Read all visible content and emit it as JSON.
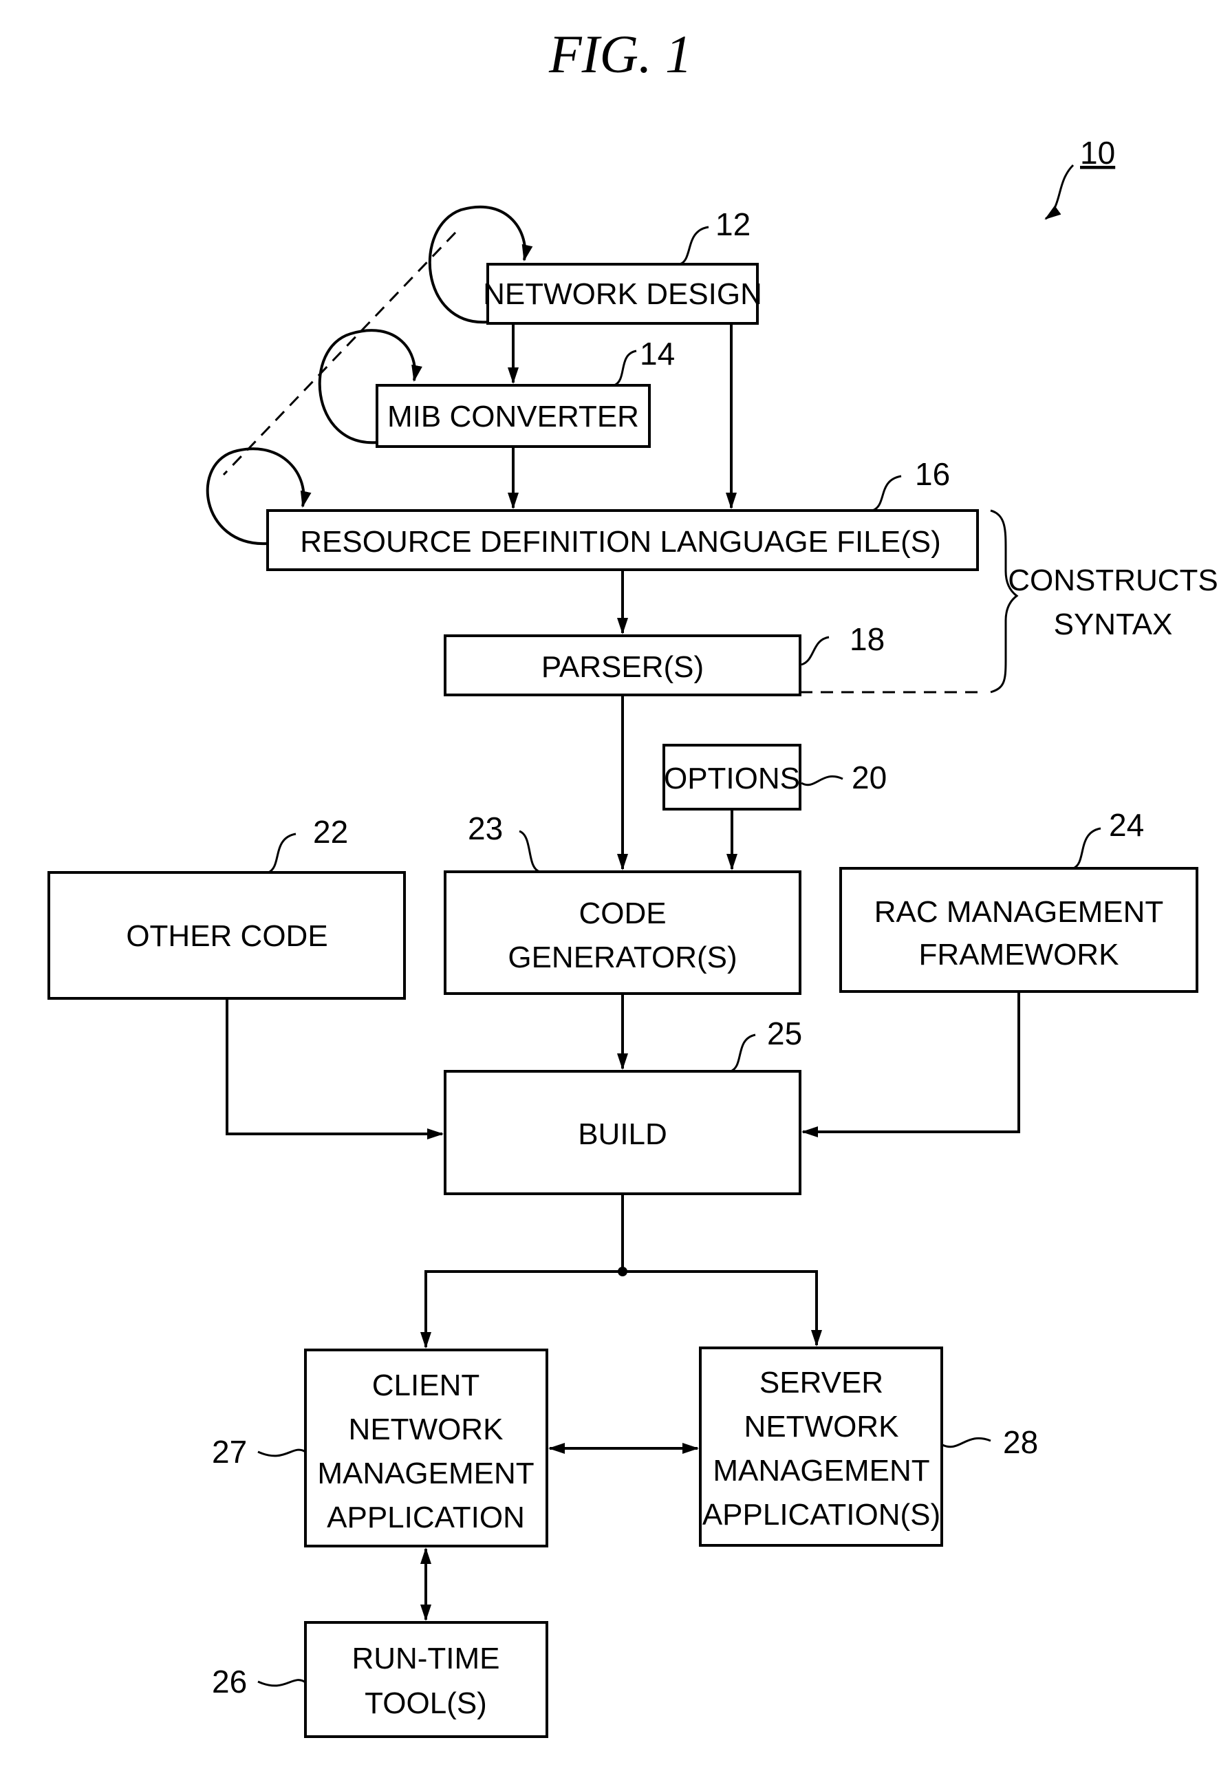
{
  "figure": {
    "title": "FIG. 1",
    "system_ref": "10"
  },
  "nodes": {
    "network_design": {
      "ref": "12",
      "lines": [
        "NETWORK DESIGN"
      ]
    },
    "mib_converter": {
      "ref": "14",
      "lines": [
        "MIB CONVERTER"
      ]
    },
    "rdl_files": {
      "ref": "16",
      "lines": [
        "RESOURCE DEFINITION LANGUAGE FILE(S)"
      ]
    },
    "parsers": {
      "ref": "18",
      "lines": [
        "PARSER(S)"
      ]
    },
    "options": {
      "ref": "20",
      "lines": [
        "OPTIONS"
      ]
    },
    "other_code": {
      "ref": "22",
      "lines": [
        "OTHER CODE"
      ]
    },
    "code_generators": {
      "ref": "23",
      "lines": [
        "CODE",
        "GENERATOR(S)"
      ]
    },
    "rac_framework": {
      "ref": "24",
      "lines": [
        "RAC MANAGEMENT",
        "FRAMEWORK"
      ]
    },
    "build": {
      "ref": "25",
      "lines": [
        "BUILD"
      ]
    },
    "runtime_tools": {
      "ref": "26",
      "lines": [
        "RUN-TIME",
        "TOOL(S)"
      ]
    },
    "client_app": {
      "ref": "27",
      "lines": [
        "CLIENT",
        "NETWORK",
        "MANAGEMENT",
        "APPLICATION"
      ]
    },
    "server_app": {
      "ref": "28",
      "lines": [
        "SERVER",
        "NETWORK",
        "MANAGEMENT",
        "APPLICATION(S)"
      ]
    }
  },
  "brace_label": [
    "CONSTRUCTS",
    "SYNTAX"
  ],
  "edges": [
    {
      "from": "network_design",
      "to": "mib_converter"
    },
    {
      "from": "network_design",
      "to": "rdl_files"
    },
    {
      "from": "mib_converter",
      "to": "rdl_files"
    },
    {
      "from": "rdl_files",
      "to": "parsers"
    },
    {
      "from": "parsers",
      "to": "code_generators"
    },
    {
      "from": "options",
      "to": "code_generators"
    },
    {
      "from": "code_generators",
      "to": "build"
    },
    {
      "from": "other_code",
      "to": "build"
    },
    {
      "from": "rac_framework",
      "to": "build"
    },
    {
      "from": "build",
      "to": "client_app"
    },
    {
      "from": "build",
      "to": "server_app"
    },
    {
      "from": "client_app",
      "to": "server_app",
      "bidirectional": true
    },
    {
      "from": "client_app",
      "to": "runtime_tools",
      "bidirectional": true
    },
    {
      "from": "network_design",
      "to": "network_design",
      "type": "loop"
    },
    {
      "from": "mib_converter",
      "to": "mib_converter",
      "type": "loop"
    },
    {
      "from": "rdl_files",
      "to": "rdl_files",
      "type": "loop"
    }
  ]
}
